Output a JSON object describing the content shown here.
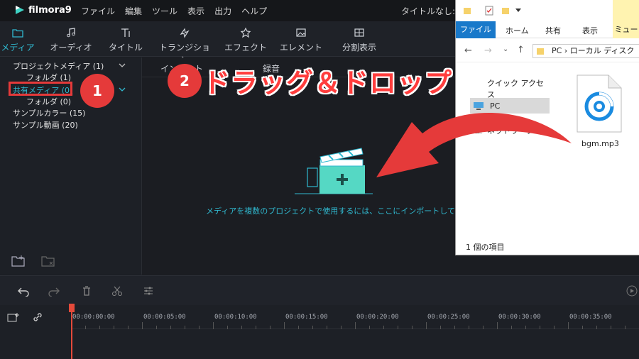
{
  "app": {
    "name": "filmora9",
    "title_right": "タイトルなし:"
  },
  "menu": [
    "ファイル",
    "編集",
    "ツール",
    "表示",
    "出力",
    "ヘルプ"
  ],
  "tabs": [
    {
      "label": "メディア",
      "icon": "folder-icon"
    },
    {
      "label": "オーディオ",
      "icon": "music-note-icon"
    },
    {
      "label": "タイトル",
      "icon": "text-icon"
    },
    {
      "label": "トランジション",
      "icon": "transition-icon"
    },
    {
      "label": "エフェクト",
      "icon": "effect-icon"
    },
    {
      "label": "エレメント",
      "icon": "image-icon"
    },
    {
      "label": "分割表示",
      "icon": "split-screen-icon"
    }
  ],
  "sidebar": {
    "items": [
      {
        "label": "プロジェクトメディア (1)"
      },
      {
        "label": "フォルダ (1)"
      },
      {
        "label": "共有メディア (0)"
      },
      {
        "label": "フォルダ (0)"
      },
      {
        "label": "サンプルカラー (15)"
      },
      {
        "label": "サンプル動画 (20)"
      }
    ]
  },
  "media": {
    "import_label": "インポート",
    "record_label": "録音",
    "hint": "メディアを複数のプロジェクトで使用するには、ここにインポートしてください"
  },
  "overlay": {
    "step1": "1",
    "step2": "2",
    "title": "ドラッグ＆ドロップ"
  },
  "explorer": {
    "tabs": [
      "ファイル",
      "ホーム",
      "共有",
      "表示"
    ],
    "music_tab": "ミュー",
    "address": "PC  ›  ローカル ディスク",
    "quick_access": "クイック アクセス",
    "nav_pc": "PC",
    "nav_network": "ネットワーク",
    "file_name": "bgm.mp3",
    "status": "1 個の項目"
  },
  "timeline": {
    "ticks": [
      "00:00:00:00",
      "00:00:05:00",
      "00:00:10:00",
      "00:00:15:00",
      "00:00:20:00",
      "00:00:25:00",
      "00:00:30:00",
      "00:00:35:00"
    ]
  },
  "colors": {
    "accent": "#30b9d0",
    "highlight": "#e53a3a",
    "explorer_file_tab": "#1979ca"
  }
}
